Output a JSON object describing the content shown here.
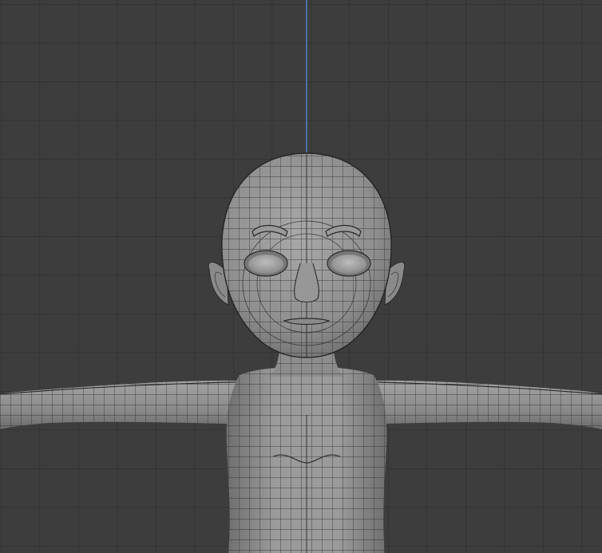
{
  "viewport": {
    "kind": "3d-viewport",
    "view": "front-orthographic",
    "shading": "solid-wireframe",
    "object": "character-base-mesh",
    "pose": "T-pose",
    "colors": {
      "background": "#3d3d3d",
      "grid_line": "#2f2f2f",
      "z_axis": "#4f7cc2",
      "mesh_fill": "#8f8f8f",
      "mesh_wire": "#2b2b2b"
    }
  }
}
